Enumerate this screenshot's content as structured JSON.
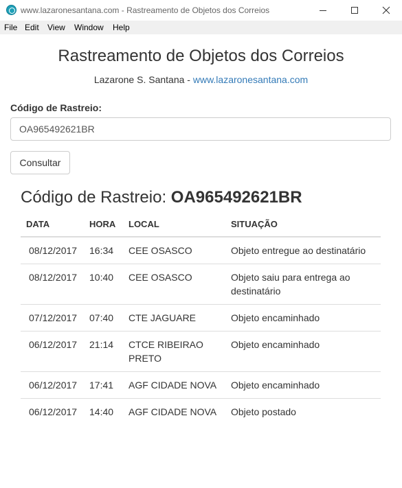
{
  "window": {
    "title": "www.lazaronesantana.com - Rastreamento de Objetos dos Correios",
    "controls": [
      "minimize",
      "maximize",
      "close"
    ]
  },
  "menu": {
    "items": [
      "File",
      "Edit",
      "View",
      "Window",
      "Help"
    ]
  },
  "header": {
    "title": "Rastreamento de Objetos dos Correios",
    "author": "Lazarone S. Santana -",
    "link": "www.lazaronesantana.com"
  },
  "form": {
    "label": "Código de Rastreio:",
    "value": "OA965492621BR",
    "button": "Consultar"
  },
  "result": {
    "heading_prefix": "Código de Rastreio:",
    "code": "OA965492621BR",
    "columns": [
      "DATA",
      "HORA",
      "LOCAL",
      "SITUAÇÃO"
    ],
    "rows": [
      {
        "data": "08/12/2017",
        "hora": "16:34",
        "local": "CEE OSASCO",
        "situacao": "Objeto entregue ao destinatário"
      },
      {
        "data": "08/12/2017",
        "hora": "10:40",
        "local": "CEE OSASCO",
        "situacao": "Objeto saiu para entrega ao destinatário"
      },
      {
        "data": "07/12/2017",
        "hora": "07:40",
        "local": "CTE JAGUARE",
        "situacao": "Objeto encaminhado"
      },
      {
        "data": "06/12/2017",
        "hora": "21:14",
        "local": "CTCE RIBEIRAO PRETO",
        "situacao": "Objeto encaminhado"
      },
      {
        "data": "06/12/2017",
        "hora": "17:41",
        "local": "AGF CIDADE NOVA",
        "situacao": "Objeto encaminhado"
      },
      {
        "data": "06/12/2017",
        "hora": "14:40",
        "local": "AGF CIDADE NOVA",
        "situacao": "Objeto postado"
      }
    ]
  }
}
